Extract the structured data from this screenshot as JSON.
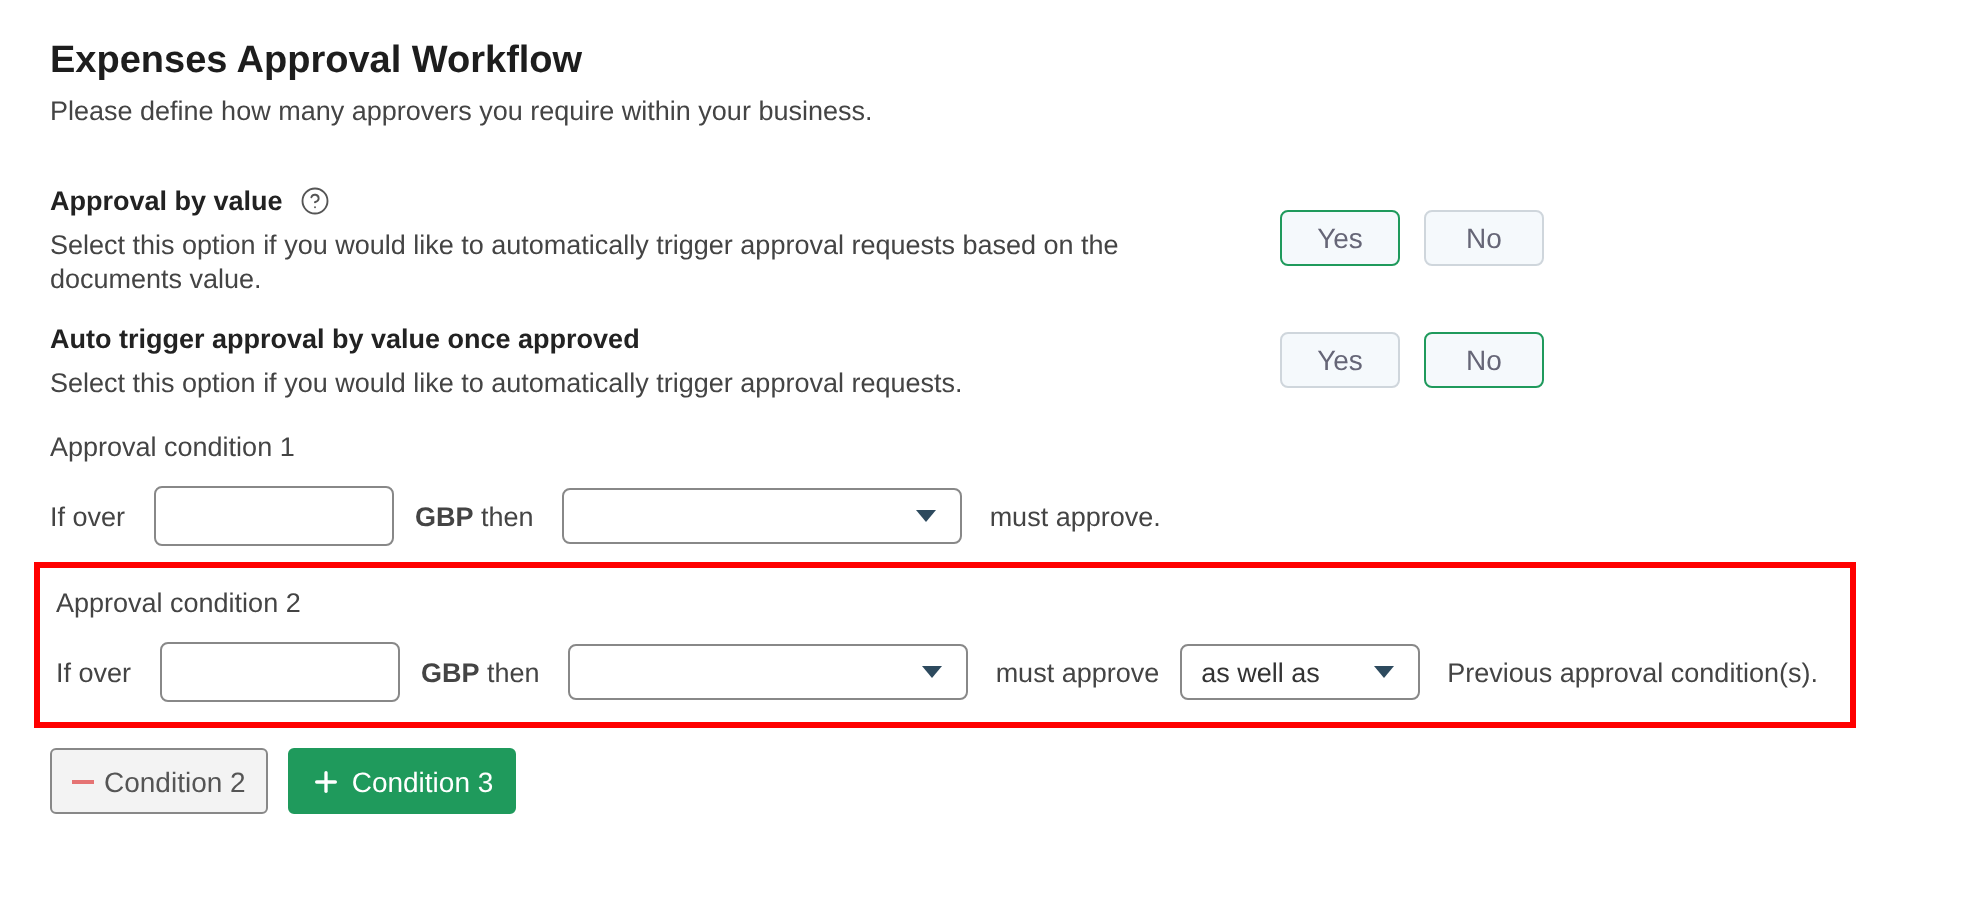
{
  "title": "Expenses Approval Workflow",
  "subtitle": "Please define how many approvers you require within your business.",
  "options": [
    {
      "label": "Approval by value",
      "help": true,
      "description": "Select this option if you would like to automatically trigger approval requests based on the documents value.",
      "choices": [
        {
          "label": "Yes",
          "selected": true
        },
        {
          "label": "No",
          "selected": false
        }
      ]
    },
    {
      "label": "Auto trigger approval by value once approved",
      "help": false,
      "description": "Select this option if you would like to automatically trigger approval requests.",
      "choices": [
        {
          "label": "Yes",
          "selected": false
        },
        {
          "label": "No",
          "selected": true
        }
      ]
    }
  ],
  "conditions": [
    {
      "title": "Approval condition 1",
      "highlighted": false,
      "prefix": "If over",
      "currency": "**GBP** then",
      "suffix": "must approve."
    },
    {
      "title": "Approval condition 2",
      "highlighted": true,
      "prefix": "If over",
      "currency": "**GBP** then",
      "suffix": "must approve",
      "combine": "as well as",
      "trailing": "Previous approval condition(s)."
    }
  ],
  "actions": [
    {
      "kind": "remove",
      "label": "Condition 2"
    },
    {
      "kind": "add",
      "label": "Condition 3"
    }
  ]
}
